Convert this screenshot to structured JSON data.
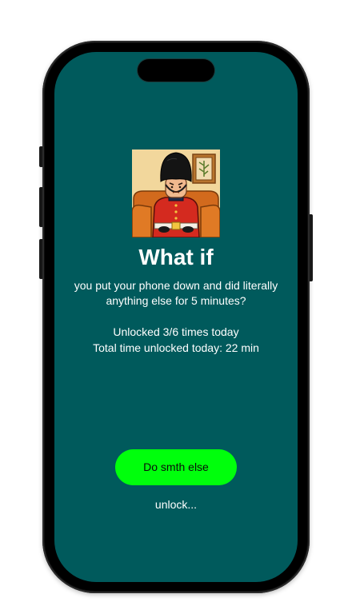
{
  "colors": {
    "screen_background": "#005a5c",
    "primary_button": "#00ff0c",
    "text": "#ffffff"
  },
  "illustration": {
    "icon": "royal-guard-illustration"
  },
  "prompt": {
    "title": "What if",
    "subtitle": "you put your phone down and did literally anything else for 5 minutes?"
  },
  "stats": {
    "unlocked_count": "Unlocked 3/6 times today",
    "total_time": "Total time unlocked today: 22 min"
  },
  "actions": {
    "primary_label": "Do smth else",
    "secondary_label": "unlock..."
  }
}
